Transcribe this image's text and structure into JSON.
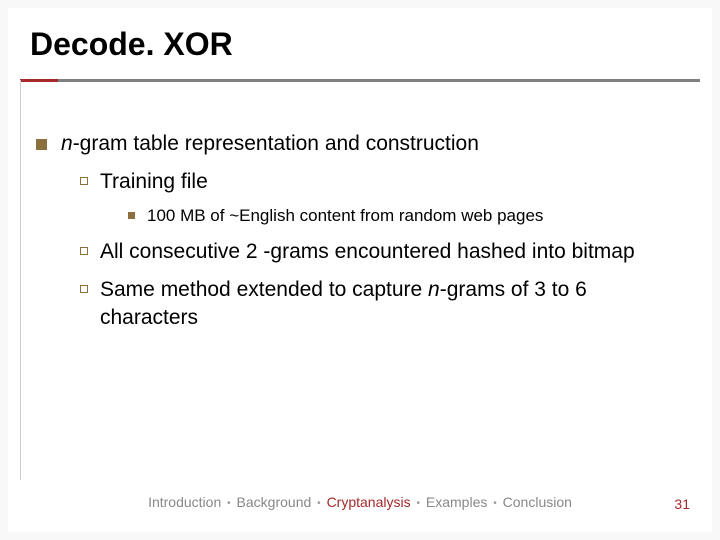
{
  "title": "Decode. XOR",
  "bullets": {
    "l1": {
      "pre": "n",
      "post": "-gram table representation and construction"
    },
    "l2a": "Training file",
    "l3a": "100 MB of ~English content from random web pages",
    "l2b": "All consecutive 2 -grams encountered hashed into bitmap",
    "l2c_pre": "Same method extended to capture ",
    "l2c_it": "n",
    "l2c_post": "-grams of 3 to 6 characters"
  },
  "footer": {
    "items": [
      "Introduction",
      "Background",
      "Cryptanalysis",
      "Examples",
      "Conclusion"
    ],
    "highlight_index": 2
  },
  "page_number": "31"
}
